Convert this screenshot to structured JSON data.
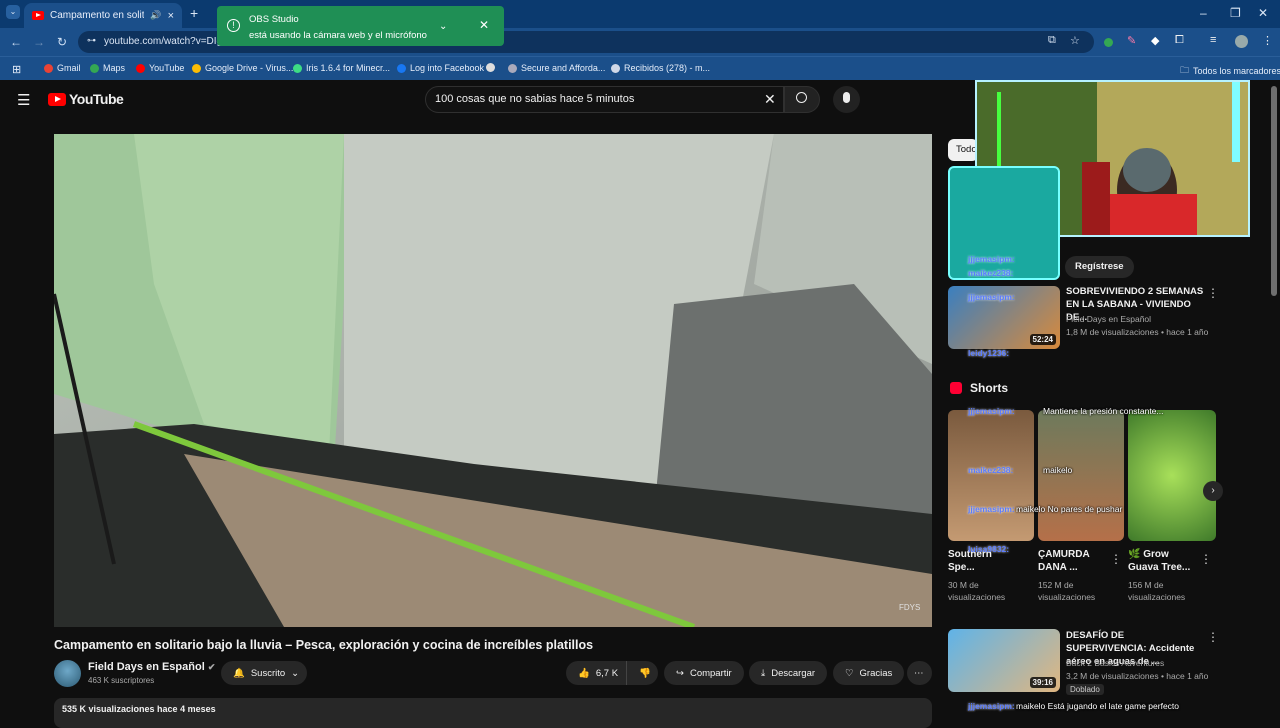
{
  "browser": {
    "tab_title": "Campamento en solitario b",
    "url": "youtube.com/watch?v=DIg",
    "bookmarks": [
      "Gmail",
      "Maps",
      "YouTube",
      "Google Drive - Virus...",
      "Iris 1.6.4 for Minecr...",
      "Log into Facebook",
      "Secure and Afforda...",
      "Recibidos (278) - m...",
      "Todos los marcadores"
    ]
  },
  "notification": {
    "title": "OBS Studio",
    "message": "está usando la cámara web y el micrófono"
  },
  "youtube": {
    "logo": "YouTube",
    "search_query": "100 cosas que no sabias hace 5 minutos",
    "video": {
      "title": "Campamento en solitario bajo la lluvia – Pesca, exploración y cocina de increíbles platillos",
      "watermark": "FDYS",
      "channel": "Field Days en Español",
      "subscribers": "463 K suscriptores",
      "subscribed_label": "Suscrito",
      "likes": "6,7 K",
      "share": "Compartir",
      "download": "Descargar",
      "thanks": "Gracias",
      "views_date": "535 K visualizaciones  hace 4 meses"
    },
    "chip_all": "Todo",
    "register_button": "Regístrese",
    "recommendations": [
      {
        "title": "SOBREVIVIENDO 2 SEMANAS EN LA SABANA - VIVIENDO DE...",
        "channel": "Field Days en Español",
        "meta": "1,8 M de visualizaciones • hace 1 año",
        "duration": "52:24"
      },
      {
        "title": "DESAFÍO DE SUPERVIVENCIA: Accidente aéreo en aguas de ...",
        "channel": "Back 2 Basics Adventures",
        "meta": "3,2 M de visualizaciones • hace 1 año",
        "duration": "39:16",
        "badge": "Doblado"
      }
    ],
    "shorts_label": "Shorts",
    "shorts": [
      {
        "title": "Southern Spe...",
        "views": "30 M de visualizaciones"
      },
      {
        "title": "ÇAMURDA DANA ...",
        "views": "152 M de visualizaciones"
      },
      {
        "title": "🌿 Grow Guava Tree...",
        "views": "156 M de visualizaciones"
      }
    ],
    "chat": [
      {
        "user": "jjjemasipm:",
        "msg": ""
      },
      {
        "user": "maikez238:",
        "msg": ""
      },
      {
        "user": "jjjemasipm:",
        "msg": ""
      },
      {
        "user": "leidy1236:",
        "msg": ""
      },
      {
        "user": "jjjemasipm:",
        "msg": "Mantiene la presión constante..."
      },
      {
        "user": "maikez238:",
        "msg": "maikelo"
      },
      {
        "user": "jjjemasipm:",
        "msg": "maikelo No pares de pushar"
      },
      {
        "user": "luisa9832:",
        "msg": ""
      },
      {
        "user": "jjjemasipm:",
        "msg": "maikelo Está jugando el late game perfecto"
      }
    ]
  },
  "colors": {
    "tabbar": "#0b3a6f",
    "chrome": "#1b4f8a",
    "obs": "#1f8f55",
    "yt_red": "#ff0000",
    "bg": "#0f0f0f"
  }
}
